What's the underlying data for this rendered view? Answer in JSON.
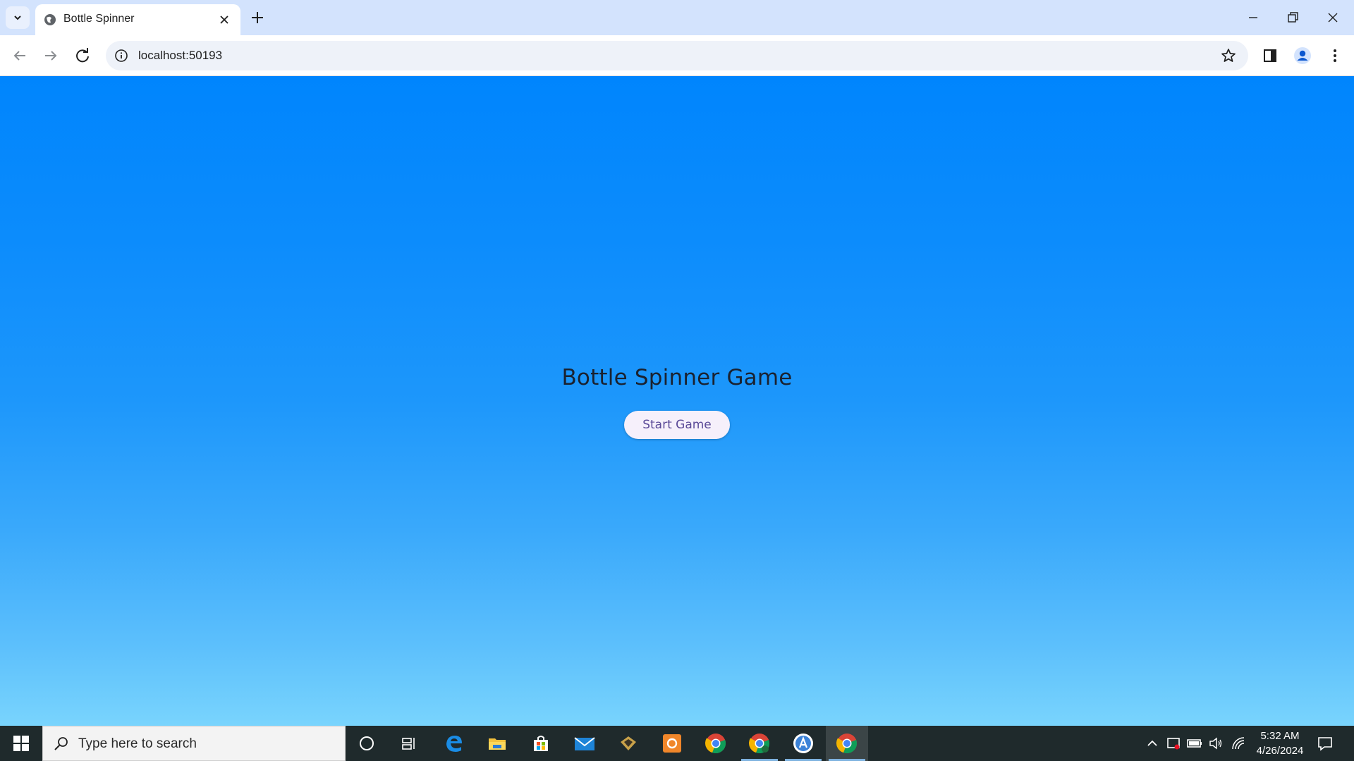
{
  "browser": {
    "tab_title": "Bottle Spinner",
    "url": "localhost:50193",
    "icons": {
      "tab_search": "chevron-down-icon",
      "favicon": "globe-icon",
      "close_tab": "close-icon",
      "new_tab": "plus-icon",
      "minimize": "minimize-icon",
      "restore": "restore-icon",
      "close_window": "close-icon",
      "back": "back-arrow-icon",
      "forward": "forward-arrow-icon",
      "reload": "reload-icon",
      "site_info": "info-icon",
      "bookmark": "star-icon",
      "side_panel": "side-panel-icon",
      "profile": "profile-icon",
      "menu": "kebab-menu-icon"
    }
  },
  "page": {
    "title": "Bottle Spinner Game",
    "start_button": "Start Game",
    "gradient_top": "#0085fd",
    "gradient_bottom": "#79d4fd"
  },
  "taskbar": {
    "search_placeholder": "Type here to search",
    "apps": [
      "cortana-icon",
      "task-view-icon",
      "edge-icon",
      "file-explorer-icon",
      "store-icon",
      "mail-icon",
      "app-icon",
      "orange-app-icon",
      "chrome-icon",
      "chrome-profile-icon",
      "app-store-icon",
      "chrome-active-icon"
    ],
    "time": "5:32 AM",
    "date": "4/26/2024"
  }
}
